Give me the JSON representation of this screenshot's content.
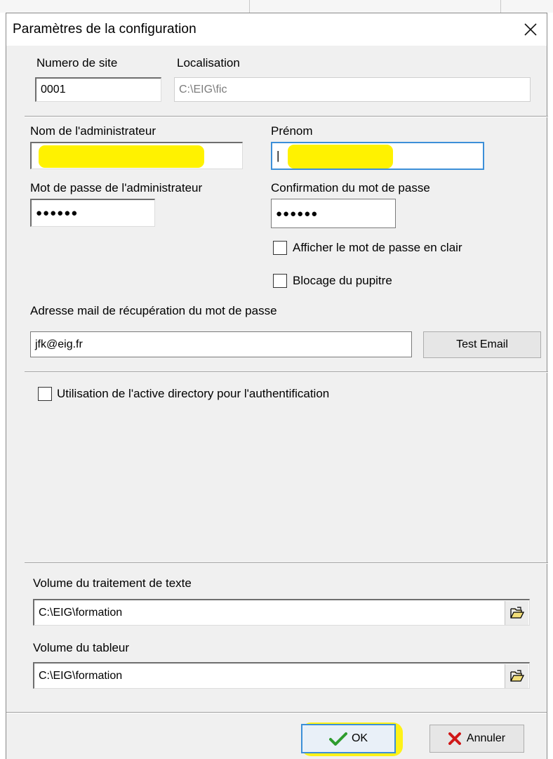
{
  "dialog": {
    "title": "Paramètres de la configuration"
  },
  "site": {
    "label": "Numero de site",
    "value": "0001"
  },
  "localisation": {
    "label": "Localisation",
    "value": "C:\\EIG\\fic"
  },
  "admin": {
    "nom_label": "Nom  de l'administrateur",
    "prenom_label": "Prénom",
    "prenom_value": "|",
    "password_label": "Mot de passe de l'administrateur",
    "password_value": "●●●●●●",
    "confirm_label": "Confirmation du mot de passe",
    "confirm_value": "●●●●●●"
  },
  "options": {
    "show_password": {
      "label": "Afficher le mot de passe en clair",
      "checked": false
    },
    "lock_console": {
      "label": "Blocage du pupitre",
      "checked": false
    }
  },
  "recovery": {
    "label": "Adresse mail de récupération du mot de passe",
    "value": "jfk@eig.fr",
    "test_button": "Test Email"
  },
  "active_directory": {
    "label": "Utilisation de l'active directory pour l'authentification",
    "checked": false
  },
  "volumes": {
    "text_processing": {
      "label": "Volume du traitement de texte",
      "value": "C:\\EIG\\formation"
    },
    "spreadsheet": {
      "label": "Volume du tableur",
      "value": "C:\\EIG\\formation"
    }
  },
  "buttons": {
    "ok": "OK",
    "cancel": "Annuler"
  },
  "colors": {
    "highlight": "#fff200",
    "focus_border": "#3c8fd8",
    "ok_check": "#2e9c2e",
    "cancel_x": "#d01818"
  },
  "icons": [
    "close-icon",
    "folder-open-icon",
    "check-icon",
    "cross-icon"
  ]
}
